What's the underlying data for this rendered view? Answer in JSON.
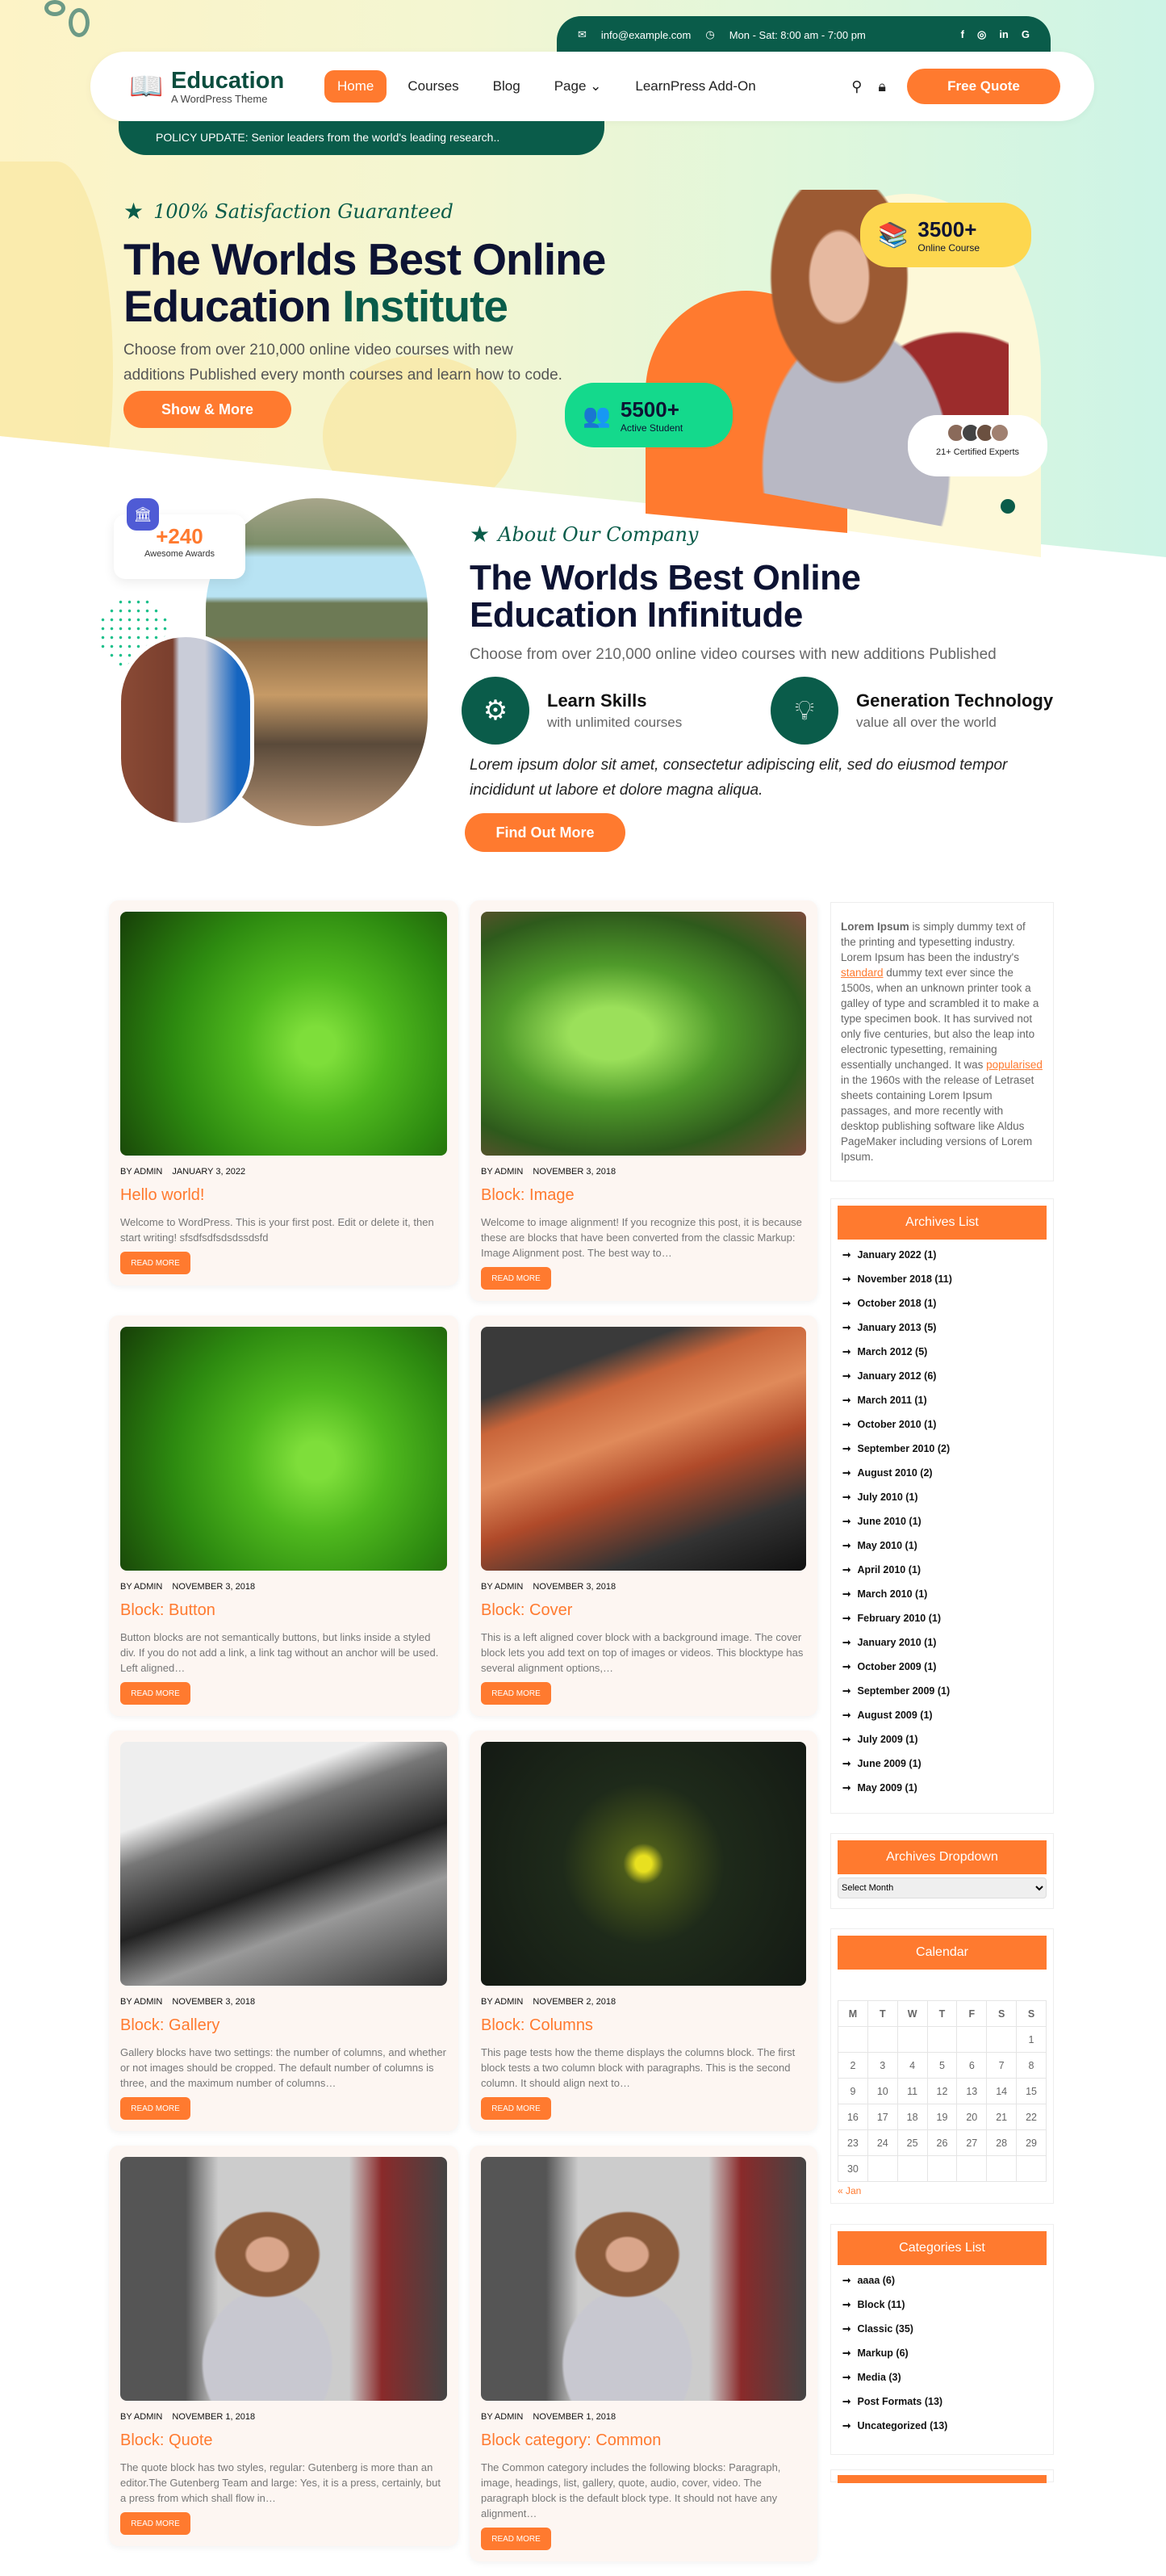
{
  "colors": {
    "accent": "#ff7a2f",
    "brand_green": "#0a5c4a",
    "navy": "#0d1333"
  },
  "topbar": {
    "email": "info@example.com",
    "hours": "Mon - Sat: 8:00 am - 7:00 pm",
    "social": [
      "facebook-icon",
      "instagram-icon",
      "linkedin-icon",
      "google-icon"
    ]
  },
  "logo": {
    "title": "Education",
    "tagline": "A WordPress Theme"
  },
  "nav": {
    "items": [
      {
        "label": "Home",
        "active": true
      },
      {
        "label": "Courses"
      },
      {
        "label": "Blog"
      },
      {
        "label": "Page ⌄"
      },
      {
        "label": "LearnPress Add-On"
      }
    ],
    "cta": "Free Quote"
  },
  "policy": "POLICY UPDATE: Senior leaders from the world's leading research..",
  "hero": {
    "tagline": "100% Satisfaction Guaranteed",
    "title_line1": "The Worlds Best Online",
    "title_line2_a": "Education ",
    "title_line2_b": "Institute",
    "description": "Choose from over 210,000 online video courses with new additions Published every month courses and learn how to code.",
    "button": "Show & More",
    "stat1": {
      "num": "3500+",
      "label": "Online Course"
    },
    "stat2": {
      "num": "5500+",
      "label": "Active Student"
    },
    "experts": "21+ Certified Experts"
  },
  "about": {
    "awards_num": "+240",
    "awards_label": "Awesome Awards",
    "tagline": "About Our Company",
    "title_line1": "The Worlds Best Online",
    "title_line2": "Education Infinitude",
    "description": "Choose from over 210,000 online video courses with new additions Published",
    "feature1": {
      "title": "Learn Skills",
      "sub": "with unlimited courses"
    },
    "feature2": {
      "title": "Generation Technology",
      "sub": "value all over the world"
    },
    "quote": "Lorem ipsum dolor sit amet, consectetur adipiscing elit, sed do eiusmod tempor incididunt ut labore et dolore magna aliqua.",
    "button": "Find Out More"
  },
  "posts": [
    {
      "image": "green-leaf-droplets",
      "author": "BY ADMIN",
      "date": "JANUARY 3, 2022",
      "title": "Hello world!",
      "excerpt": "Welcome to WordPress. This is your first post. Edit or delete it, then start writing! sfsdfsdfsdsdssdsfd",
      "button": "READ MORE"
    },
    {
      "image": "fern",
      "author": "BY ADMIN",
      "date": "NOVEMBER 3, 2018",
      "title": "Block: Image",
      "excerpt": "Welcome to image alignment! If you recognize this post, it is because these are blocks that have been converted from the classic Markup: Image Alignment post. The best way to…",
      "button": "READ MORE"
    },
    {
      "image": "green-leaf-droplets",
      "author": "BY ADMIN",
      "date": "NOVEMBER 3, 2018",
      "title": "Block: Button",
      "excerpt": "Button blocks are not semantically buttons, but links inside a styled div.  If you do not add a link, a link tag without an anchor will be used. Left aligned…",
      "button": "READ MORE"
    },
    {
      "image": "rusted-wood",
      "author": "BY ADMIN",
      "date": "NOVEMBER 3, 2018",
      "title": "Block: Cover",
      "excerpt": "This is a left aligned cover block with a background image. The cover block lets you add text on top of images or videos. This blocktype has several alignment options,…",
      "button": "READ MORE"
    },
    {
      "image": "grayscale-texture",
      "author": "BY ADMIN",
      "date": "NOVEMBER 3, 2018",
      "title": "Block: Gallery",
      "excerpt": "Gallery blocks have two settings: the number of columns, and whether or not images should be cropped. The default number of columns is three, and the maximum number of columns…",
      "button": "READ MORE"
    },
    {
      "image": "triforce-dark",
      "author": "BY ADMIN",
      "date": "NOVEMBER 2, 2018",
      "title": "Block: Columns",
      "excerpt": "This page tests how the theme displays the columns block. The first block tests a two column block with paragraphs. This is the second column. It should align next to…",
      "button": "READ MORE"
    },
    {
      "image": "woman-cheering",
      "author": "BY ADMIN",
      "date": "NOVEMBER 1, 2018",
      "title": "Block: Quote",
      "excerpt": "The quote block has two styles, regular: Gutenberg is more than an editor.The Gutenberg Team and large: Yes, it is a press, certainly, but a press from which shall flow in…",
      "button": "READ MORE"
    },
    {
      "image": "woman-cheering",
      "author": "BY ADMIN",
      "date": "NOVEMBER 1, 2018",
      "title": "Block category: Common",
      "excerpt": "The Common category includes the following blocks: Paragraph, image, headings, list, gallery, quote, audio, cover, video. The paragraph block is the default block type.  It should not have any alignment…",
      "button": "READ MORE"
    }
  ],
  "sidebar": {
    "lorem": {
      "bold": "Lorem Ipsum",
      "t1": " is simply dummy text of the printing and typesetting industry. Lorem Ipsum has been the industry's ",
      "link1": "standard",
      "t2": " dummy text ever since the 1500s, when an unknown printer took a galley of type and scrambled it to make a type specimen book. It has survived not only five centuries, but also the leap into electronic typesetting, remaining essentially unchanged. It was ",
      "link2": "popularised",
      "t3": " in the 1960s with the release of Letraset sheets containing Lorem Ipsum passages, and more recently with desktop publishing software like Aldus PageMaker including versions of Lorem Ipsum."
    },
    "archives_title": "Archives List",
    "archives": [
      "January 2022 (1)",
      "November 2018 (11)",
      "October 2018 (1)",
      "January 2013 (5)",
      "March 2012 (5)",
      "January 2012 (6)",
      "March 2011 (1)",
      "October 2010 (1)",
      "September 2010 (2)",
      "August 2010 (2)",
      "July 2010 (1)",
      "June 2010 (1)",
      "May 2010 (1)",
      "April 2010 (1)",
      "March 2010 (1)",
      "February 2010 (1)",
      "January 2010 (1)",
      "October 2009 (1)",
      "September 2009 (1)",
      "August 2009 (1)",
      "July 2009 (1)",
      "June 2009 (1)",
      "May 2009 (1)"
    ],
    "dropdown_title": "Archives Dropdown",
    "dropdown_value": "Select Month",
    "calendar_title": "Calendar",
    "calendar": {
      "days": [
        "M",
        "T",
        "W",
        "T",
        "F",
        "S",
        "S"
      ],
      "weeks": [
        [
          "",
          "",
          "",
          "",
          "",
          "",
          "1"
        ],
        [
          "2",
          "3",
          "4",
          "5",
          "6",
          "7",
          "8"
        ],
        [
          "9",
          "10",
          "11",
          "12",
          "13",
          "14",
          "15"
        ],
        [
          "16",
          "17",
          "18",
          "19",
          "20",
          "21",
          "22"
        ],
        [
          "23",
          "24",
          "25",
          "26",
          "27",
          "28",
          "29"
        ],
        [
          "30",
          "",
          "",
          "",
          "",
          "",
          ""
        ]
      ],
      "prev": "« Jan"
    },
    "categories_title": "Categories List",
    "categories": [
      "aaaa (6)",
      "Block (11)",
      "Classic (35)",
      "Markup (6)",
      "Media (3)",
      "Post Formats (13)",
      "Uncategorized (13)"
    ]
  }
}
